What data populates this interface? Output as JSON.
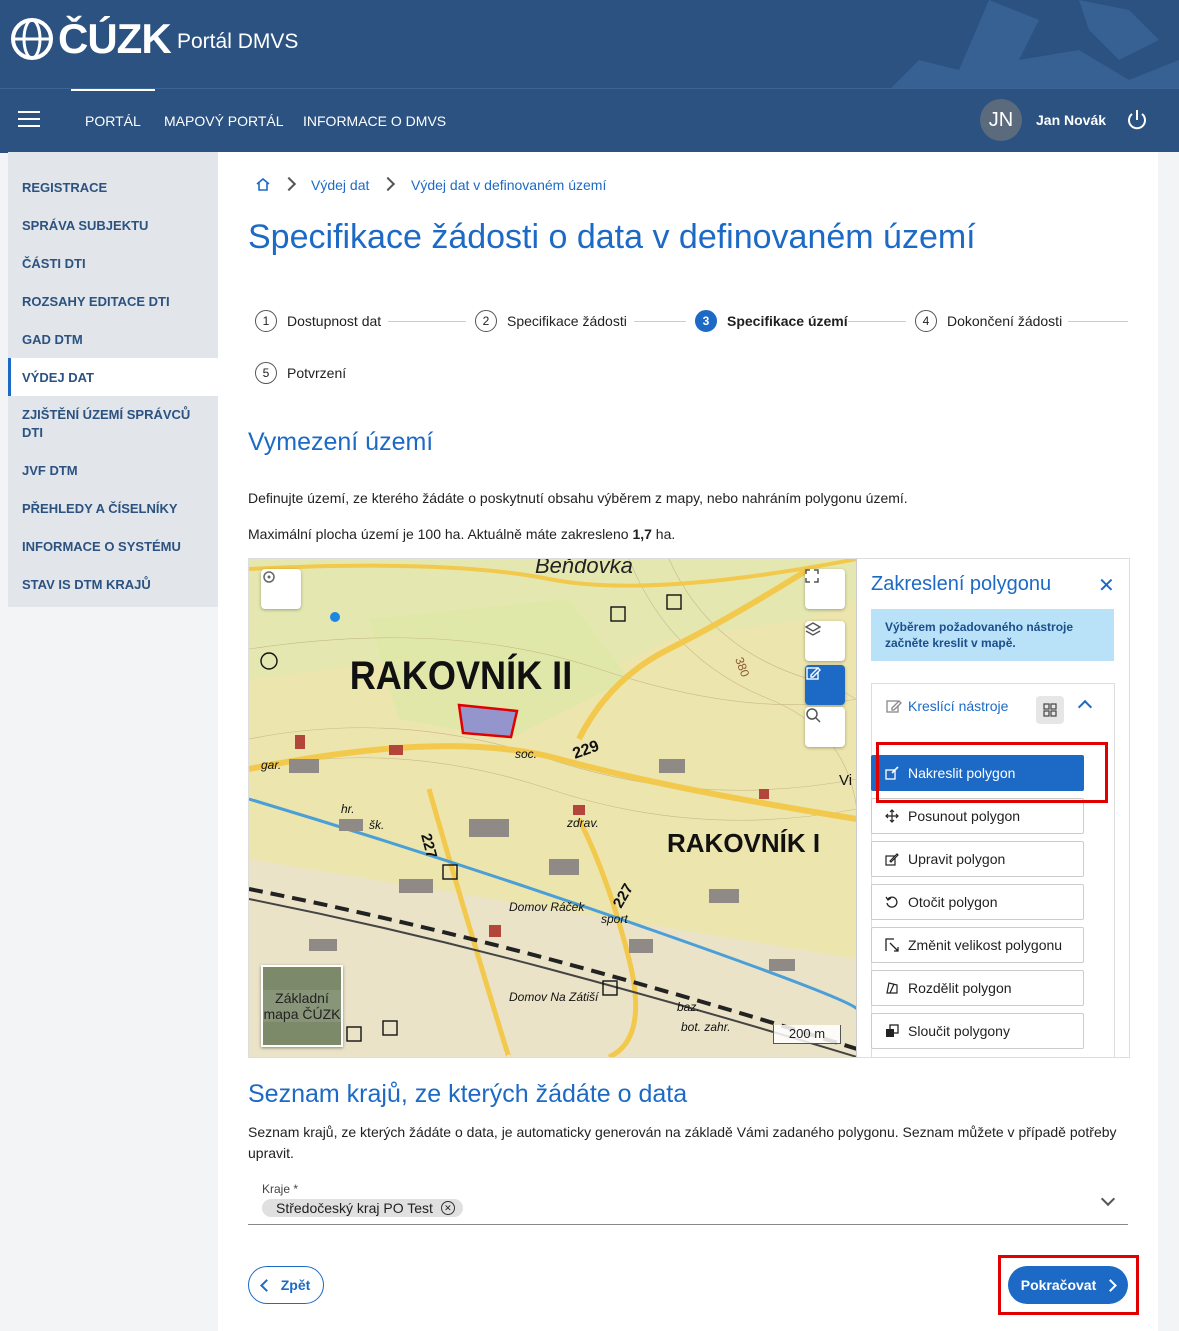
{
  "header": {
    "logo_text": "ČÚZK",
    "app_title": "Portál DMVS"
  },
  "nav": {
    "items": [
      "PORTÁL",
      "MAPOVÝ PORTÁL",
      "INFORMACE O DMVS"
    ],
    "active": "PORTÁL",
    "user_initials": "JN",
    "user_name": "Jan Novák"
  },
  "sidebar": {
    "items": [
      "REGISTRACE",
      "SPRÁVA SUBJEKTU",
      "ČÁSTI DTI",
      "ROZSAHY EDITACE DTI",
      "GAD DTM",
      "VÝDEJ DAT",
      "ZJIŠTĚNÍ ÚZEMÍ SPRÁVCŮ DTI",
      "JVF DTM",
      "PŘEHLEDY A ČÍSELNÍKY",
      "INFORMACE O SYSTÉMU",
      "STAV IS DTM KRAJŮ"
    ],
    "active": "VÝDEJ DAT"
  },
  "breadcrumb": [
    "Výdej dat",
    "Výdej dat v definovaném území"
  ],
  "page_title": "Specifikace žádosti o data v definovaném území",
  "steps": [
    {
      "num": "1",
      "label": "Dostupnost dat"
    },
    {
      "num": "2",
      "label": "Specifikace žádosti"
    },
    {
      "num": "3",
      "label": "Specifikace území",
      "active": true
    },
    {
      "num": "4",
      "label": "Dokončení žádosti"
    },
    {
      "num": "5",
      "label": "Potvrzení"
    }
  ],
  "section1": {
    "title": "Vymezení území",
    "desc": "Definujte území, ze kterého žádáte o poskytnutí obsahu výběrem z mapy, nebo nahráním polygonu území.",
    "area_prefix": "Maximální plocha území je 100 ha. Aktuálně máte zakresleno ",
    "area_value": "1,7",
    "area_suffix": " ha."
  },
  "map": {
    "labels": [
      "Beňdovka",
      "RAKOVNÍK II",
      "RAKOVNÍK I",
      "229",
      "227",
      "227",
      "soc.",
      "šk.",
      "gar.",
      "hr.",
      "zdrav.",
      "Domov Ráček",
      "sport",
      "Domov Na Zátiší",
      "baz.",
      "bot. zahr.",
      "Vi",
      "380"
    ],
    "basemap_label": "Základní mapa ČÚZK",
    "scale": "200 m"
  },
  "panel": {
    "title": "Zakreslení polygonu",
    "info": "Výběrem požadovaného nástroje začněte kreslit v mapě.",
    "tools_heading": "Kreslící nástroje",
    "tools": [
      {
        "label": "Nakreslit polygon",
        "icon": "draw-polygon-icon",
        "primary": true
      },
      {
        "label": "Posunout polygon",
        "icon": "move-icon"
      },
      {
        "label": "Upravit polygon",
        "icon": "edit-polygon-icon"
      },
      {
        "label": "Otočit polygon",
        "icon": "rotate-icon"
      },
      {
        "label": "Změnit velikost polygonu",
        "icon": "resize-icon"
      },
      {
        "label": "Rozdělit polygon",
        "icon": "split-icon"
      },
      {
        "label": "Sloučit polygony",
        "icon": "merge-icon"
      }
    ]
  },
  "section2": {
    "title": "Seznam krajů, ze kterých žádáte o data",
    "desc": "Seznam krajů, ze kterých žádáte o data, je automaticky generován na základě Vámi zadaného polygonu. Seznam můžete v případě potřeby upravit.",
    "field_label": "Kraje *",
    "chip": "Středočeský kraj PO Test"
  },
  "buttons": {
    "back": "Zpět",
    "next": "Pokračovat"
  },
  "colors": {
    "header_bg": "#2b5281",
    "accent": "#1c6ac6",
    "highlight": "#e10000",
    "info_bg": "#b9e1f8"
  }
}
